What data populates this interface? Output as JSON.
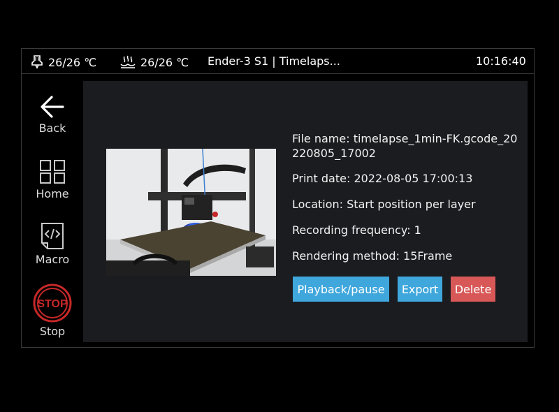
{
  "status": {
    "nozzle_temp": "26/26 ℃",
    "bed_temp": "26/26 ℃",
    "title": "Ender-3 S1 | Timelaps...",
    "time": "10:16:40"
  },
  "sidebar": {
    "items": [
      {
        "label": "Back",
        "icon": "arrow-left-icon"
      },
      {
        "label": "Home",
        "icon": "grid-icon"
      },
      {
        "label": "Macro",
        "icon": "code-file-icon"
      },
      {
        "label": "Stop",
        "icon": "stop-sign-icon",
        "icon_text": "STOP"
      }
    ]
  },
  "detail": {
    "file_name": "File name: timelapse_1min-FK.gcode_20220805_17002",
    "print_date": "Print date: 2022-08-05 17:00:13",
    "location": "Location: Start position per layer",
    "frequency": "Recording frequency: 1",
    "rendering": "Rendering method: 15Frame"
  },
  "buttons": {
    "playback": "Playback/pause",
    "export": "Export",
    "delete": "Delete"
  },
  "colors": {
    "accent_blue": "#3fa7dc",
    "danger_red": "#d85858",
    "stop_red": "#c62828",
    "panel_bg": "#1b1c20"
  }
}
